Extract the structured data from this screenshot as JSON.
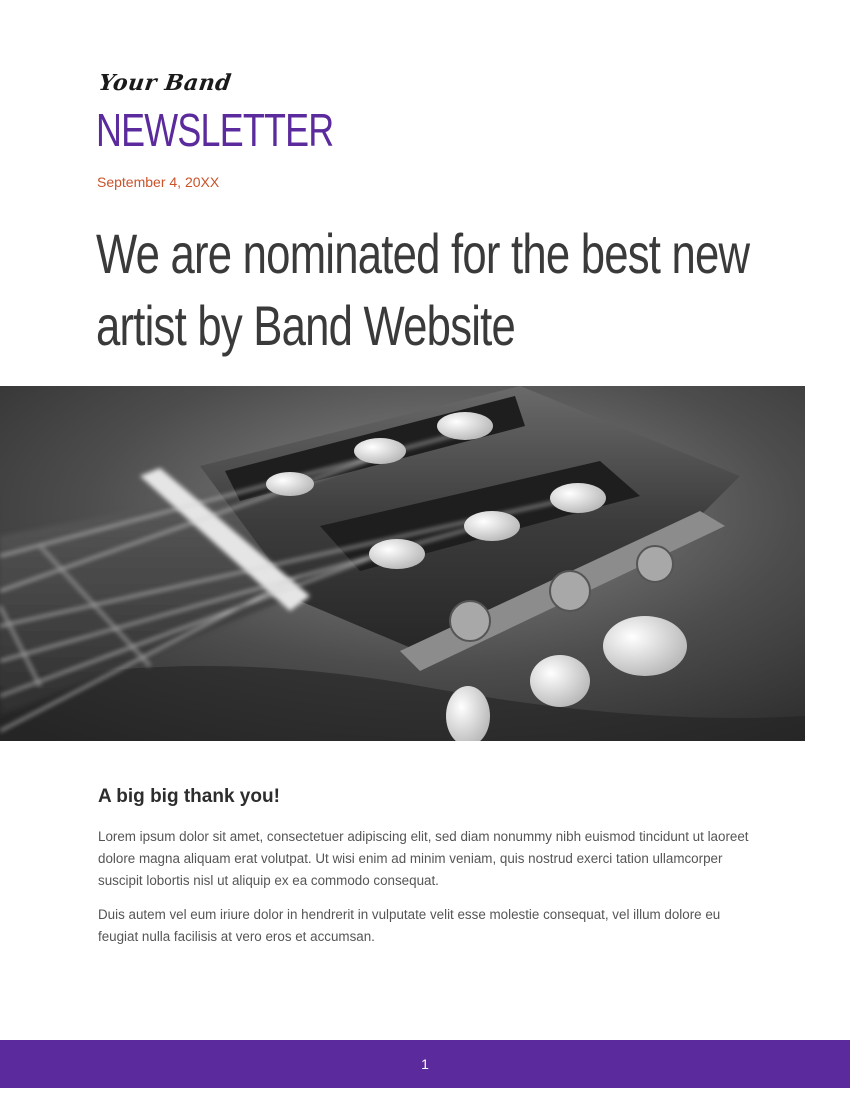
{
  "header": {
    "band_name": "Your Band",
    "masthead": "NEWSLETTER",
    "date": "September 4, 20XX"
  },
  "article": {
    "headline": "We are nominated for the best new artist by Band Website",
    "section_heading": "A big big thank you!",
    "paragraphs": [
      "Lorem ipsum dolor sit amet, consectetuer adipiscing elit, sed diam nonummy nibh euismod tincidunt ut laoreet dolore magna aliquam erat volutpat. Ut wisi enim ad minim veniam, quis nostrud exerci tation ullamcorper suscipit lobortis nisl ut aliquip ex ea commodo consequat.",
      "Duis autem vel eum iriure dolor in hendrerit in vulputate velit esse molestie consequat, vel illum dolore eu feugiat nulla facilisis at vero eros et accumsan."
    ]
  },
  "footer": {
    "page_number": "1"
  },
  "colors": {
    "accent_purple": "#5b2a9c",
    "date_orange": "#c9532a",
    "headline_gray": "#3a3a3a"
  },
  "images": {
    "hero": "guitar-headstock-photo"
  }
}
